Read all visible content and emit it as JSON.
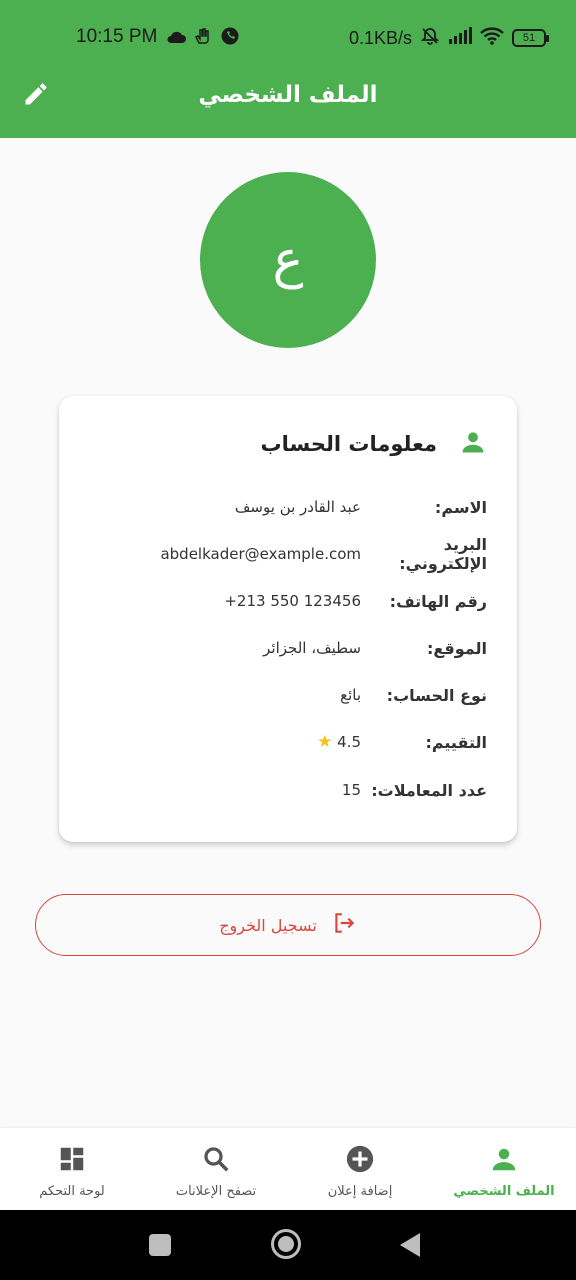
{
  "status_bar": {
    "time": "10:15 PM",
    "network_speed": "0.1KB/s",
    "battery": "51",
    "icons_left": [
      "cloud-icon",
      "hand-icon",
      "whatsapp-icon"
    ],
    "icons_right": [
      "mute-bell-icon",
      "signal-icon",
      "wifi-icon",
      "battery-icon"
    ]
  },
  "app_bar": {
    "title": "الملف الشخصي",
    "edit_icon": "edit-icon"
  },
  "avatar": {
    "initial": "ع"
  },
  "account_card": {
    "title": "معلومات الحساب",
    "icon": "person-icon",
    "rows": [
      {
        "label": "الاسم:",
        "value": "عبد القادر بن يوسف"
      },
      {
        "label": "البريد الإلكتروني:",
        "value": "abdelkader@example.com"
      },
      {
        "label": "رقم الهاتف:",
        "value": "+213 550 123456"
      },
      {
        "label": "الموقع:",
        "value": "سطيف، الجزائر"
      },
      {
        "label": "نوع الحساب:",
        "value": "بائع"
      },
      {
        "label": "التقييم:",
        "value": "4.5"
      },
      {
        "label": "عدد المعاملات:",
        "value": "15"
      }
    ],
    "rating_icon": "star-icon"
  },
  "logout": {
    "label": "تسجيل الخروج",
    "icon": "logout-icon"
  },
  "bottom_nav": {
    "items": [
      {
        "label": "الملف الشخصي",
        "icon": "person-icon",
        "active": true
      },
      {
        "label": "إضافة إعلان",
        "icon": "add-circle-icon",
        "active": false
      },
      {
        "label": "تصفح الإعلانات",
        "icon": "search-icon",
        "active": false
      },
      {
        "label": "لوحة التحكم",
        "icon": "dashboard-icon",
        "active": false
      }
    ]
  },
  "colors": {
    "primary": "#4caf50",
    "logout": "#d9473f",
    "star": "#f4c21b"
  }
}
